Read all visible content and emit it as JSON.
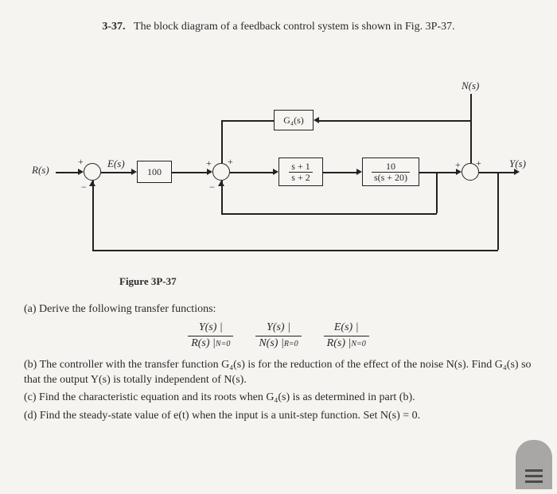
{
  "problem": {
    "number": "3-37.",
    "statement": "The block diagram of a feedback control system is shown in Fig. 3P-37."
  },
  "diagram": {
    "labels": {
      "R": "R(s)",
      "E": "E(s)",
      "N": "N(s)",
      "Y": "Y(s)",
      "G4": "G₄(s)",
      "k": "100",
      "tf1_num": "s + 1",
      "tf1_den": "s + 2",
      "tf2_num": "10",
      "tf2_den": "s(s + 20)"
    },
    "caption": "Figure 3P-37"
  },
  "parts": {
    "a_lead": "(a) Derive the following transfer functions:",
    "tf_list": [
      {
        "num": "Y(s)",
        "den": "R(s)",
        "cond": "N=0"
      },
      {
        "num": "Y(s)",
        "den": "N(s)",
        "cond": "R=0"
      },
      {
        "num": "E(s)",
        "den": "R(s)",
        "cond": "N=0"
      }
    ],
    "b": "(b) The controller with the transfer function G₄(s) is for the reduction of the effect of the noise N(s). Find G₄(s) so that the output Y(s) is totally independent of N(s).",
    "c": "(c) Find the characteristic equation and its roots when G₄(s) is as determined in part (b).",
    "d": "(d) Find the steady-state value of e(t) when the input is a unit-step function. Set N(s) = 0."
  }
}
